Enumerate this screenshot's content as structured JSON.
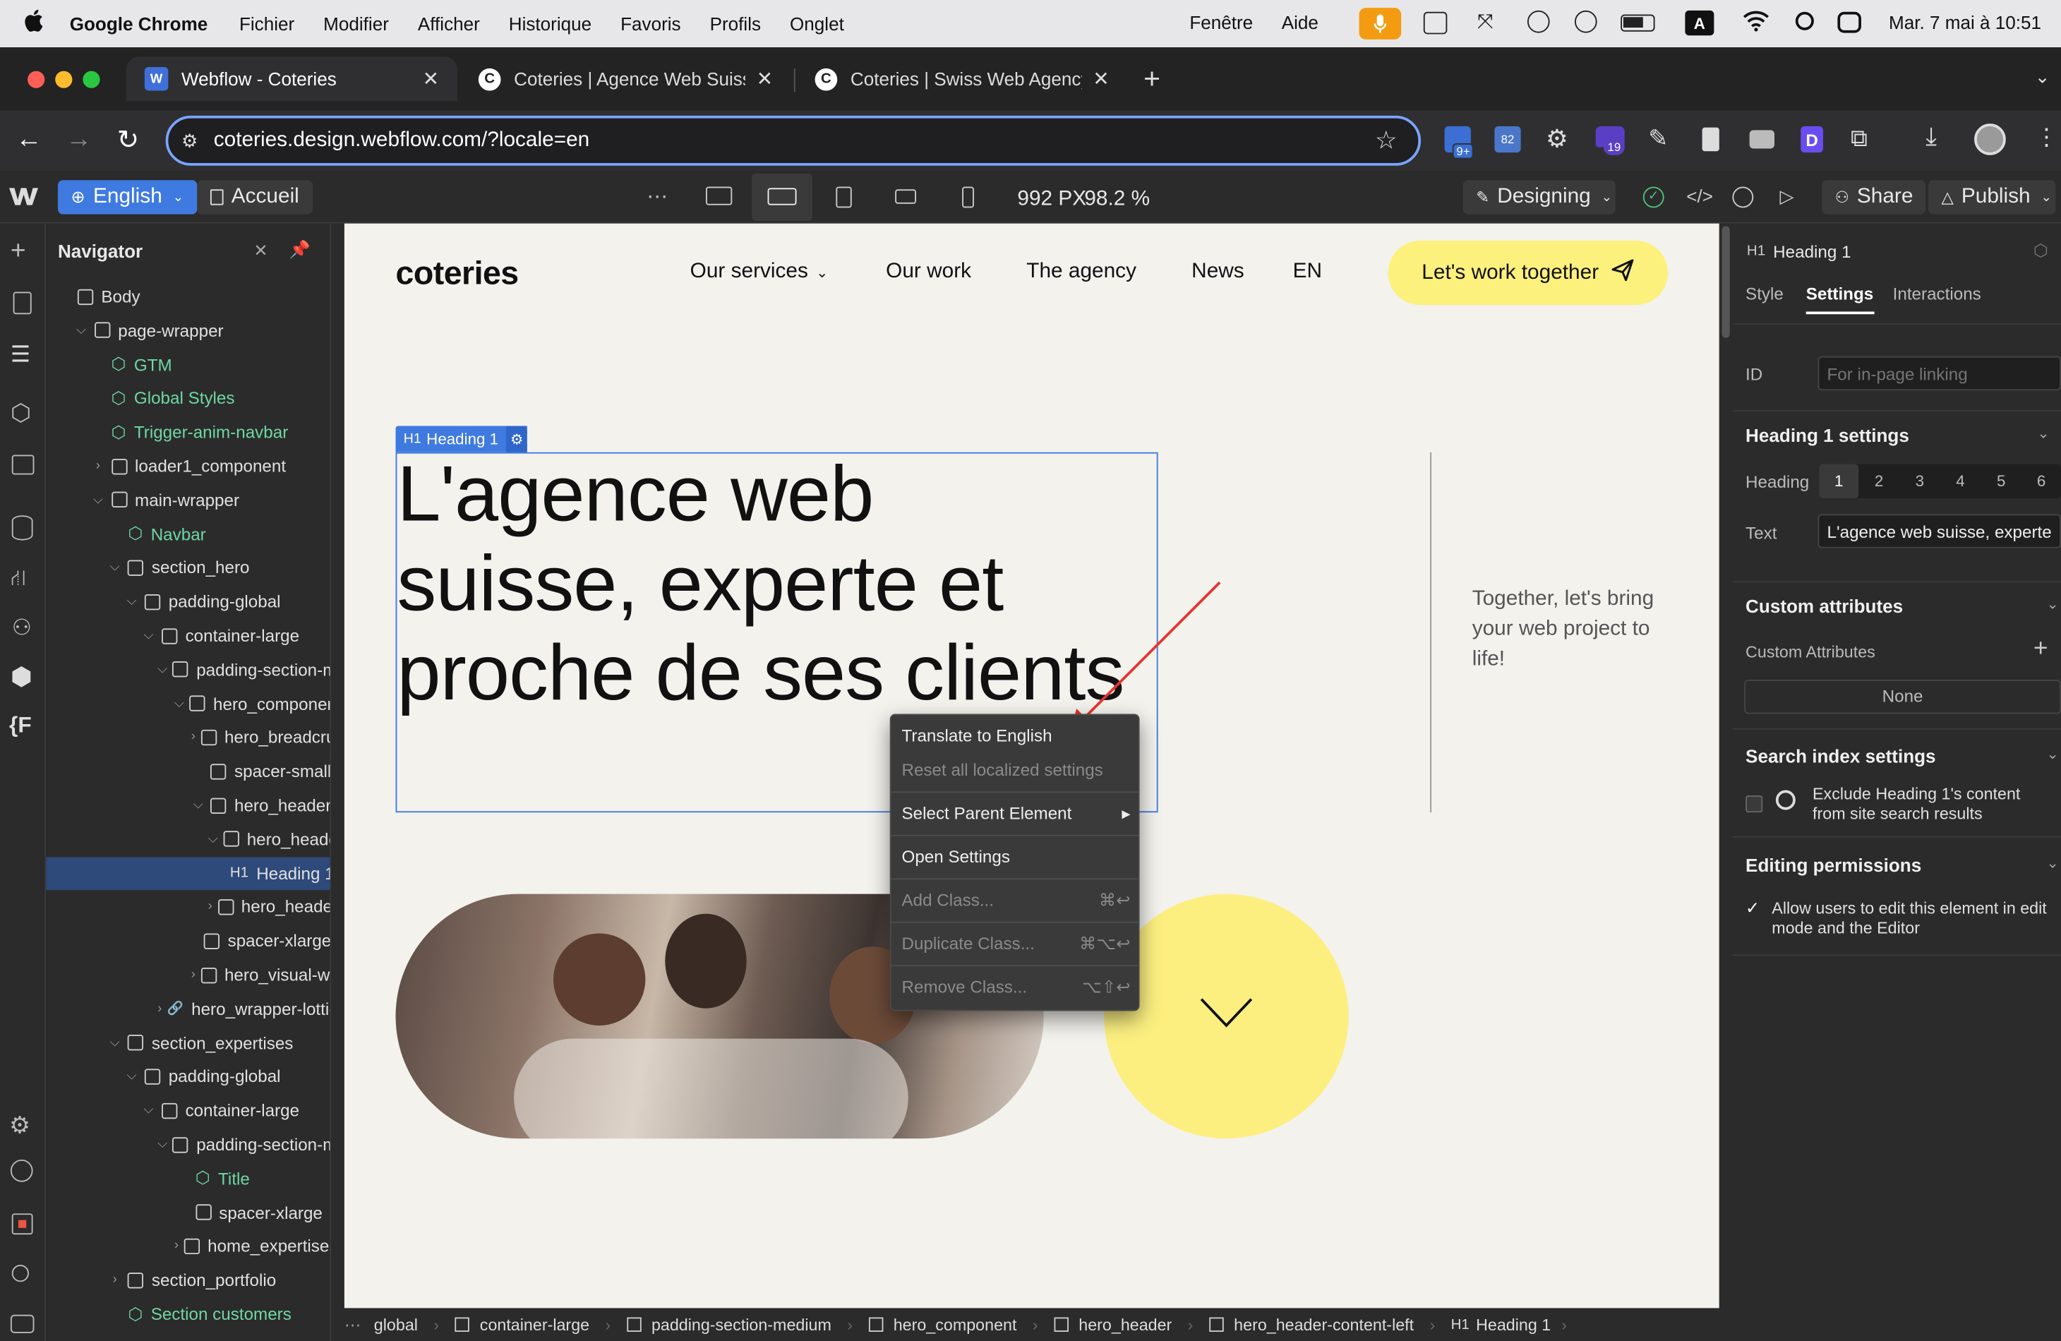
{
  "menubar": {
    "app": "Google Chrome",
    "items": [
      "Fichier",
      "Modifier",
      "Afficher",
      "Historique",
      "Favoris",
      "Profils",
      "Onglet"
    ],
    "right_items": [
      "Fenêtre",
      "Aide"
    ],
    "clock": "Mar. 7 mai à 10:51",
    "input_badge": "A"
  },
  "tabs": [
    {
      "title": "Webflow - Coteries",
      "icon": "W"
    },
    {
      "title": "Coteries | Agence Web Suisse",
      "icon": "C"
    },
    {
      "title": "Coteries | Swiss Web Agency",
      "icon": "C"
    }
  ],
  "address": {
    "url": "coteries.design.webflow.com/?locale=en"
  },
  "ext_badges": {
    "one": "9+",
    "two": "82",
    "three": "19"
  },
  "wf_toolbar": {
    "locale": "English",
    "page": "Accueil",
    "size_px": "992 PX",
    "zoom": "98.2 %",
    "mode": "Designing",
    "share": "Share",
    "publish": "Publish"
  },
  "navigator": {
    "title": "Navigator",
    "rows": [
      {
        "label": "Body",
        "kind": "box",
        "depth": 0
      },
      {
        "label": "page-wrapper",
        "kind": "box",
        "depth": 1,
        "chev": "v"
      },
      {
        "label": "GTM",
        "kind": "comp",
        "depth": 2
      },
      {
        "label": "Global Styles",
        "kind": "comp",
        "depth": 2
      },
      {
        "label": "Trigger-anim-navbar",
        "kind": "comp",
        "depth": 2
      },
      {
        "label": "loader1_component",
        "kind": "box",
        "depth": 2,
        "chev": ">"
      },
      {
        "label": "main-wrapper",
        "kind": "box",
        "depth": 2,
        "chev": "v"
      },
      {
        "label": "Navbar",
        "kind": "comp",
        "depth": 3
      },
      {
        "label": "section_hero",
        "kind": "box",
        "depth": 3,
        "chev": "v"
      },
      {
        "label": "padding-global",
        "kind": "box",
        "depth": 4,
        "chev": "v"
      },
      {
        "label": "container-large",
        "kind": "box",
        "depth": 5,
        "chev": "v"
      },
      {
        "label": "padding-section-m",
        "kind": "box",
        "depth": 6,
        "chev": "v"
      },
      {
        "label": "hero_component",
        "kind": "box",
        "depth": 7,
        "chev": "v"
      },
      {
        "label": "hero_breadcru",
        "kind": "box",
        "depth": 8,
        "chev": ">"
      },
      {
        "label": "spacer-small",
        "kind": "box",
        "depth": 8
      },
      {
        "label": "hero_header",
        "kind": "box",
        "depth": 8,
        "chev": "v"
      },
      {
        "label": "hero_header",
        "kind": "box",
        "depth": 9,
        "chev": "v"
      },
      {
        "label": "Heading 1",
        "kind": "h1",
        "depth": 10,
        "selected": true
      },
      {
        "label": "hero_header",
        "kind": "box",
        "depth": 9,
        "chev": ">"
      },
      {
        "label": "spacer-xlarge",
        "kind": "box",
        "depth": 8
      },
      {
        "label": "hero_visual-wr",
        "kind": "box",
        "depth": 8,
        "chev": ">"
      },
      {
        "label": "hero_wrapper-lottie",
        "kind": "link",
        "depth": 6,
        "chev": ">"
      },
      {
        "label": "section_expertises",
        "kind": "box",
        "depth": 3,
        "chev": "v"
      },
      {
        "label": "padding-global",
        "kind": "box",
        "depth": 4,
        "chev": "v"
      },
      {
        "label": "container-large",
        "kind": "box",
        "depth": 5,
        "chev": "v"
      },
      {
        "label": "padding-section-m",
        "kind": "box",
        "depth": 6,
        "chev": "v"
      },
      {
        "label": "Title",
        "kind": "comp",
        "depth": 7
      },
      {
        "label": "spacer-xlarge",
        "kind": "box",
        "depth": 7
      },
      {
        "label": "home_expertises",
        "kind": "box",
        "depth": 7,
        "chev": ">"
      },
      {
        "label": "section_portfolio",
        "kind": "box",
        "depth": 3,
        "chev": ">"
      },
      {
        "label": "Section customers",
        "kind": "comp",
        "depth": 3
      }
    ]
  },
  "site": {
    "logo": "coteries",
    "nav": [
      "Our services",
      "Our work",
      "The agency",
      "News",
      "EN"
    ],
    "cta": "Let's work together",
    "heading": "L'agence web suisse, experte et proche de ses clients",
    "heading_tag_type": "H1",
    "heading_tag_label": "Heading 1",
    "aside": "Together, let's bring your web project to life!"
  },
  "context_menu": {
    "items": [
      {
        "label": "Translate to English",
        "shortcut": "",
        "disabled": false
      },
      {
        "label": "Reset all localized settings",
        "shortcut": "",
        "disabled": true
      },
      {
        "label": "Select Parent Element",
        "shortcut": "▸",
        "disabled": false
      },
      {
        "label": "Open Settings",
        "shortcut": "",
        "disabled": false
      },
      {
        "label": "Add Class...",
        "shortcut": "⌘↩",
        "disabled": true
      },
      {
        "label": "Duplicate Class...",
        "shortcut": "⌘⌥↩",
        "disabled": true
      },
      {
        "label": "Remove Class...",
        "shortcut": "⌥⇧↩",
        "disabled": true
      }
    ]
  },
  "breadcrumb": {
    "items": [
      "global",
      "container-large",
      "padding-section-medium",
      "hero_component",
      "hero_header",
      "hero_header-content-left"
    ],
    "last_tag": "H1",
    "last_label": "Heading 1"
  },
  "panel": {
    "element_tag": "H1",
    "element_label": "Heading 1",
    "tabs": [
      "Style",
      "Settings",
      "Interactions"
    ],
    "id_label": "ID",
    "id_placeholder": "For in-page linking",
    "heading_settings_title": "Heading 1 settings",
    "heading_label": "Heading",
    "levels": [
      "1",
      "2",
      "3",
      "4",
      "5",
      "6"
    ],
    "text_label": "Text",
    "text_value": "L'agence web suisse, experte",
    "custom_attr_title": "Custom attributes",
    "custom_attr_label": "Custom Attributes",
    "custom_attr_none": "None",
    "search_title": "Search index settings",
    "search_text": "Exclude Heading 1's content from site search results",
    "perm_title": "Editing permissions",
    "perm_text": "Allow users to edit this element in edit mode and the Editor"
  },
  "colors": {
    "accent": "#3f7ae0",
    "cta_yellow": "#fdf17e",
    "circle_yellow": "#fcef80",
    "canvas": "#f3f2ed",
    "arrow": "#e8322b"
  }
}
